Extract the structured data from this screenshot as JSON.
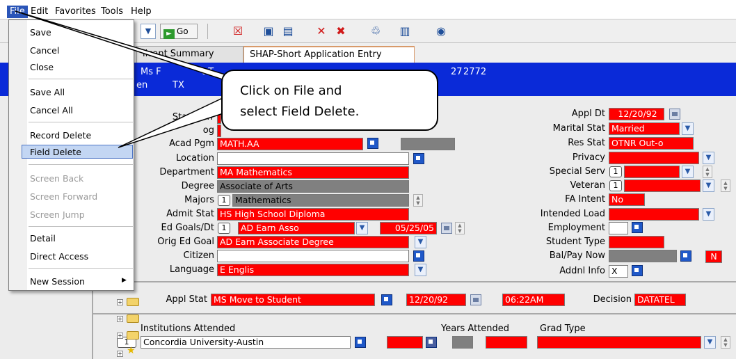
{
  "menubar": {
    "items": [
      "File",
      "Edit",
      "Favorites",
      "Tools",
      "Help"
    ]
  },
  "toolbar": {
    "go_label": "Go",
    "dropdown_icon": "chevron-down-icon"
  },
  "tabs": [
    "licant Summary",
    "SHAP-Short Application Entry"
  ],
  "header": {
    "line1_a": "Ms F",
    "line1_b": "t T.",
    "line1_c": "27",
    "line1_d": "2772",
    "line2_a": "en",
    "line2_b": "TX"
  },
  "file_menu": {
    "items": [
      "Save",
      "Cancel",
      "Close",
      "Save All",
      "Cancel All",
      "Record Delete",
      "Field Delete",
      "Screen Back",
      "Screen Forward",
      "Screen Jump",
      "Detail",
      "Direct Access",
      "New Session"
    ],
    "new_session_arrow": "▶"
  },
  "callout": {
    "line1": "Click on File and",
    "line2": "select Field Delete."
  },
  "form": {
    "start_term_label": "Start Terr",
    "catalog_label": "og",
    "acad_pgm_label": "Acad Pgm",
    "acad_pgm_value": "MATH.AA",
    "location_label": "Location",
    "department_label": "Department",
    "department_value": "MA    Mathematics",
    "degree_label": "Degree",
    "degree_value": "Associate of Arts",
    "majors_label": "Majors",
    "majors_count": "1",
    "majors_value": "Mathematics",
    "admit_stat_label": "Admit Stat",
    "admit_stat_value": "HS    High School Diploma",
    "ed_goals_label": "Ed Goals/Dt",
    "ed_goals_count": "1",
    "ed_goals_value": "AD    Earn Asso",
    "ed_goals_date": "05/25/05",
    "orig_ed_goal_label": "Orig Ed Goal",
    "orig_ed_goal_value": "AD    Earn Associate Degree",
    "citizen_label": "Citizen",
    "language_label": "Language",
    "language_value": "E              Englis",
    "appl_dt_label": "Appl Dt",
    "appl_dt_value": "12/20/92",
    "marital_stat_label": "Marital Stat",
    "marital_stat_value": "Married",
    "res_stat_label": "Res Stat",
    "res_stat_value": "OTNR  Out-o",
    "privacy_label": "Privacy",
    "special_serv_label": "Special Serv",
    "special_serv_count": "1",
    "veteran_label": "Veteran",
    "veteran_count": "1",
    "fa_intent_label": "FA Intent",
    "fa_intent_value": "No",
    "intended_load_label": "Intended Load",
    "employment_label": "Employment",
    "student_type_label": "Student Type",
    "bal_pay_label": "Bal/Pay Now",
    "bal_pay_value": "N",
    "addnl_info_label": "Addnl Info",
    "addnl_info_value": "X",
    "appl_stat_label": "Appl Stat",
    "appl_stat_value": "MS Move to Student",
    "appl_stat_date": "12/20/92",
    "appl_stat_time": "06:22AM",
    "decision_label": "Decision",
    "decision_value": "DATATEL",
    "institutions_label": "Institutions Attended",
    "years_attended_label": "Years Attended",
    "grad_type_label": "Grad Type",
    "institution_count": "1",
    "institution_value": "Concordia University-Austin"
  },
  "colors": {
    "required_field": "#ff0000",
    "readonly_field": "#808080",
    "header_blue": "#0a2ad8",
    "menu_highlight": "#c3d6f3"
  }
}
